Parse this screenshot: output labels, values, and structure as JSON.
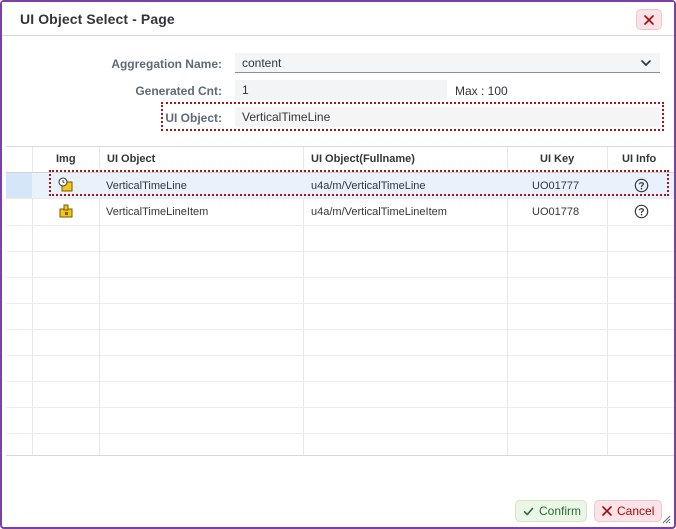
{
  "dialog": {
    "title": "UI Object Select - Page",
    "close_icon": "close-icon"
  },
  "form": {
    "aggregation_label": "Aggregation Name:",
    "aggregation_value": "content",
    "generated_label": "Generated Cnt:",
    "generated_value": "1",
    "max_text": "Max : 100",
    "uiobject_label": "UI Object:",
    "uiobject_value": "VerticalTimeLine"
  },
  "table": {
    "headers": {
      "img": "Img",
      "ui_object": "UI Object",
      "fullname": "UI Object(Fullname)",
      "ui_key": "UI Key",
      "ui_info": "UI Info"
    },
    "rows": [
      {
        "icon": "timeline-icon",
        "ui_object": "VerticalTimeLine",
        "fullname": "u4a/m/VerticalTimeLine",
        "ui_key": "UO01777",
        "info_icon": "help-circle-icon",
        "selected": true
      },
      {
        "icon": "puzzle-item-icon",
        "ui_object": "VerticalTimeLineItem",
        "fullname": "u4a/m/VerticalTimeLineItem",
        "ui_key": "UO01778",
        "info_icon": "help-circle-icon",
        "selected": false
      }
    ]
  },
  "footer": {
    "confirm_label": "Confirm",
    "cancel_label": "Cancel"
  },
  "colors": {
    "frame_border": "#7b3fa8",
    "highlight_dotted": "#a4161a",
    "confirm_text": "#256f3a",
    "cancel_text": "#aa0808",
    "selected_row": "#e9f2fb"
  }
}
